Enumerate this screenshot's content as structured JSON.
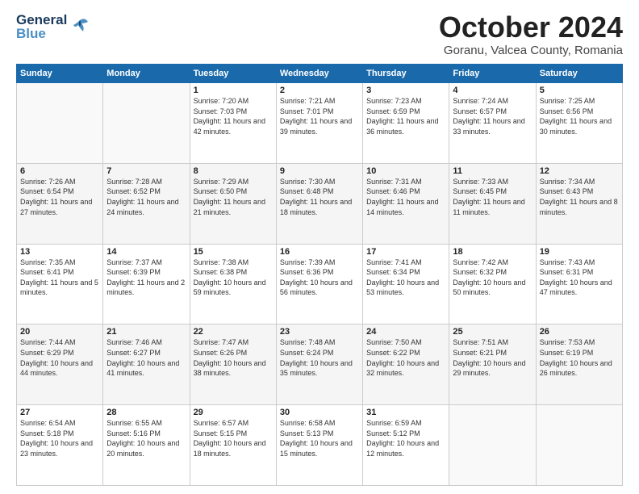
{
  "header": {
    "logo_general": "General",
    "logo_blue": "Blue",
    "month_title": "October 2024",
    "location": "Goranu, Valcea County, Romania"
  },
  "weekdays": [
    "Sunday",
    "Monday",
    "Tuesday",
    "Wednesday",
    "Thursday",
    "Friday",
    "Saturday"
  ],
  "weeks": [
    [
      {
        "day": "",
        "info": ""
      },
      {
        "day": "",
        "info": ""
      },
      {
        "day": "1",
        "info": "Sunrise: 7:20 AM\nSunset: 7:03 PM\nDaylight: 11 hours and 42 minutes."
      },
      {
        "day": "2",
        "info": "Sunrise: 7:21 AM\nSunset: 7:01 PM\nDaylight: 11 hours and 39 minutes."
      },
      {
        "day": "3",
        "info": "Sunrise: 7:23 AM\nSunset: 6:59 PM\nDaylight: 11 hours and 36 minutes."
      },
      {
        "day": "4",
        "info": "Sunrise: 7:24 AM\nSunset: 6:57 PM\nDaylight: 11 hours and 33 minutes."
      },
      {
        "day": "5",
        "info": "Sunrise: 7:25 AM\nSunset: 6:56 PM\nDaylight: 11 hours and 30 minutes."
      }
    ],
    [
      {
        "day": "6",
        "info": "Sunrise: 7:26 AM\nSunset: 6:54 PM\nDaylight: 11 hours and 27 minutes."
      },
      {
        "day": "7",
        "info": "Sunrise: 7:28 AM\nSunset: 6:52 PM\nDaylight: 11 hours and 24 minutes."
      },
      {
        "day": "8",
        "info": "Sunrise: 7:29 AM\nSunset: 6:50 PM\nDaylight: 11 hours and 21 minutes."
      },
      {
        "day": "9",
        "info": "Sunrise: 7:30 AM\nSunset: 6:48 PM\nDaylight: 11 hours and 18 minutes."
      },
      {
        "day": "10",
        "info": "Sunrise: 7:31 AM\nSunset: 6:46 PM\nDaylight: 11 hours and 14 minutes."
      },
      {
        "day": "11",
        "info": "Sunrise: 7:33 AM\nSunset: 6:45 PM\nDaylight: 11 hours and 11 minutes."
      },
      {
        "day": "12",
        "info": "Sunrise: 7:34 AM\nSunset: 6:43 PM\nDaylight: 11 hours and 8 minutes."
      }
    ],
    [
      {
        "day": "13",
        "info": "Sunrise: 7:35 AM\nSunset: 6:41 PM\nDaylight: 11 hours and 5 minutes."
      },
      {
        "day": "14",
        "info": "Sunrise: 7:37 AM\nSunset: 6:39 PM\nDaylight: 11 hours and 2 minutes."
      },
      {
        "day": "15",
        "info": "Sunrise: 7:38 AM\nSunset: 6:38 PM\nDaylight: 10 hours and 59 minutes."
      },
      {
        "day": "16",
        "info": "Sunrise: 7:39 AM\nSunset: 6:36 PM\nDaylight: 10 hours and 56 minutes."
      },
      {
        "day": "17",
        "info": "Sunrise: 7:41 AM\nSunset: 6:34 PM\nDaylight: 10 hours and 53 minutes."
      },
      {
        "day": "18",
        "info": "Sunrise: 7:42 AM\nSunset: 6:32 PM\nDaylight: 10 hours and 50 minutes."
      },
      {
        "day": "19",
        "info": "Sunrise: 7:43 AM\nSunset: 6:31 PM\nDaylight: 10 hours and 47 minutes."
      }
    ],
    [
      {
        "day": "20",
        "info": "Sunrise: 7:44 AM\nSunset: 6:29 PM\nDaylight: 10 hours and 44 minutes."
      },
      {
        "day": "21",
        "info": "Sunrise: 7:46 AM\nSunset: 6:27 PM\nDaylight: 10 hours and 41 minutes."
      },
      {
        "day": "22",
        "info": "Sunrise: 7:47 AM\nSunset: 6:26 PM\nDaylight: 10 hours and 38 minutes."
      },
      {
        "day": "23",
        "info": "Sunrise: 7:48 AM\nSunset: 6:24 PM\nDaylight: 10 hours and 35 minutes."
      },
      {
        "day": "24",
        "info": "Sunrise: 7:50 AM\nSunset: 6:22 PM\nDaylight: 10 hours and 32 minutes."
      },
      {
        "day": "25",
        "info": "Sunrise: 7:51 AM\nSunset: 6:21 PM\nDaylight: 10 hours and 29 minutes."
      },
      {
        "day": "26",
        "info": "Sunrise: 7:53 AM\nSunset: 6:19 PM\nDaylight: 10 hours and 26 minutes."
      }
    ],
    [
      {
        "day": "27",
        "info": "Sunrise: 6:54 AM\nSunset: 5:18 PM\nDaylight: 10 hours and 23 minutes."
      },
      {
        "day": "28",
        "info": "Sunrise: 6:55 AM\nSunset: 5:16 PM\nDaylight: 10 hours and 20 minutes."
      },
      {
        "day": "29",
        "info": "Sunrise: 6:57 AM\nSunset: 5:15 PM\nDaylight: 10 hours and 18 minutes."
      },
      {
        "day": "30",
        "info": "Sunrise: 6:58 AM\nSunset: 5:13 PM\nDaylight: 10 hours and 15 minutes."
      },
      {
        "day": "31",
        "info": "Sunrise: 6:59 AM\nSunset: 5:12 PM\nDaylight: 10 hours and 12 minutes."
      },
      {
        "day": "",
        "info": ""
      },
      {
        "day": "",
        "info": ""
      }
    ]
  ]
}
